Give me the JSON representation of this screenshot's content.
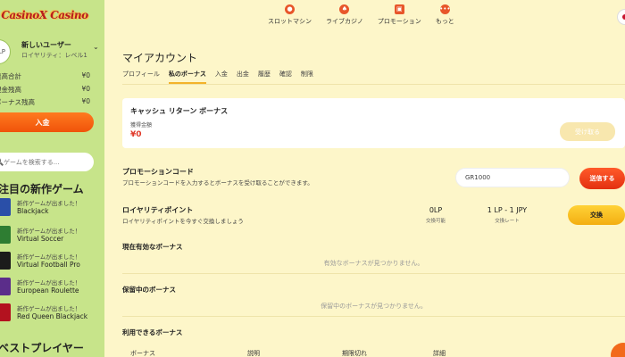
{
  "sidebar": {
    "logo_text": "CasinoX Casino",
    "avatar_text": "LP",
    "user_name": "新しいユーザー",
    "user_level": "ロイヤリティ：レベル1",
    "balances": [
      {
        "label": "残高合計",
        "value": "¥0"
      },
      {
        "label": "現金残高",
        "value": "¥0"
      },
      {
        "label": "ボーナス残高",
        "value": "¥0"
      }
    ],
    "deposit_label": "入金",
    "search_placeholder": "ゲームを検索する...",
    "new_games_title": "注目の新作ゲーム",
    "new_badge": "新作ゲームが出ました！",
    "games": [
      {
        "name": "Blackjack",
        "color": "#2a4fa8"
      },
      {
        "name": "Virtual Soccer",
        "color": "#2e7d32"
      },
      {
        "name": "Virtual Football Pro",
        "color": "#1b1b1b"
      },
      {
        "name": "European Roulette",
        "color": "#5b2d8a"
      },
      {
        "name": "Red Queen Blackjack",
        "color": "#b3121f"
      }
    ],
    "best_players_title": "ベストプレイヤー"
  },
  "topnav": [
    {
      "label": "スロットマシン",
      "icon": "cherry-icon"
    },
    {
      "label": "ライブカジノ",
      "icon": "dealer-icon"
    },
    {
      "label": "プロモーション",
      "icon": "gift-icon"
    },
    {
      "label": "もっと",
      "icon": "more-icon"
    }
  ],
  "main": {
    "title": "マイアカウント",
    "tabs": [
      "プロフィール",
      "私のボーナス",
      "入金",
      "出金",
      "履歴",
      "確認",
      "制限"
    ],
    "active_tab": 1,
    "cashback": {
      "title": "キャッシュ リターン ボーナス",
      "sub_label": "獲得金額",
      "amount": "¥0",
      "button": "受け取る"
    },
    "promo": {
      "title": "プロモーションコード",
      "desc": "プロモーションコードを入力するとボーナスを受け取ることができます。",
      "value": "GR1000",
      "button": "送信する"
    },
    "loyalty": {
      "title": "ロイヤリティポイント",
      "desc": "ロイヤリティポイントを今すぐ交換しましょう",
      "points": "0LP",
      "points_label": "交換可能",
      "rate": "1 LP - 1 JPY",
      "rate_label": "交換レート",
      "button": "交換"
    },
    "active_bonuses": {
      "title": "現在有効なボーナス",
      "empty": "有効なボーナスが見つかりません。"
    },
    "pending_bonuses": {
      "title": "保留中のボーナス",
      "empty": "保留中のボーナスが見つかりません。"
    },
    "available_bonuses": {
      "title": "利用できるボーナス",
      "columns": [
        "ボーナス",
        "説明",
        "期限切れ",
        "詳細"
      ]
    }
  },
  "colors": {
    "accent": "#f26a1b",
    "sidebar_bg": "#c7e48a",
    "page_bg": "#fdf6c9"
  }
}
